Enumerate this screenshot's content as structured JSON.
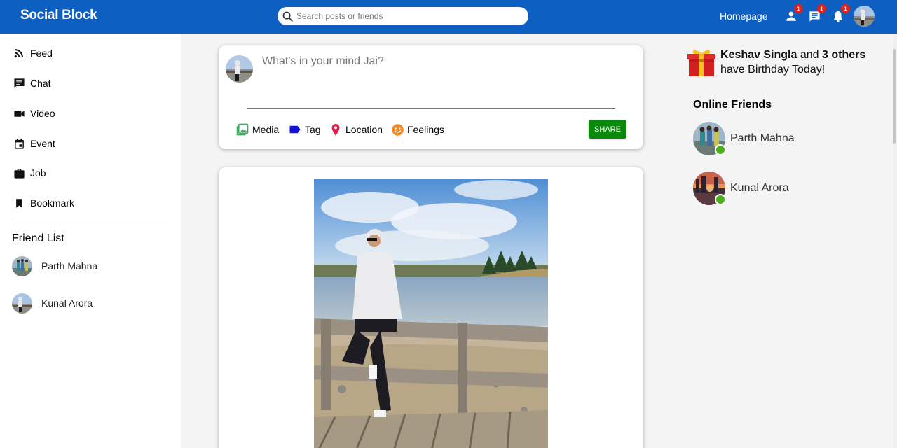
{
  "app": {
    "name": "Social Block"
  },
  "header": {
    "search_placeholder": "Search posts or friends",
    "homepage_label": "Homepage",
    "notifications": [
      {
        "icon": "person-icon",
        "count": "1"
      },
      {
        "icon": "chat-icon",
        "count": "1"
      },
      {
        "icon": "bell-icon",
        "count": "1"
      }
    ]
  },
  "sidebar": {
    "items": [
      {
        "label": "Feed",
        "icon": "rss-feed-icon"
      },
      {
        "label": "Chat",
        "icon": "chat-icon"
      },
      {
        "label": "Video",
        "icon": "video-camera-icon"
      },
      {
        "label": "Event",
        "icon": "calendar-icon"
      },
      {
        "label": "Job",
        "icon": "briefcase-icon"
      },
      {
        "label": "Bookmark",
        "icon": "bookmark-icon"
      }
    ],
    "friend_list_title": "Friend List",
    "friends": [
      {
        "name": "Parth Mahna"
      },
      {
        "name": "Kunal Arora"
      }
    ]
  },
  "share": {
    "placeholder": "What's in your mind Jai?",
    "options": [
      {
        "label": "Media",
        "icon": "image-icon",
        "color": "#3fae61"
      },
      {
        "label": "Tag",
        "icon": "label-icon",
        "color": "#1212d6"
      },
      {
        "label": "Location",
        "icon": "location-pin-icon",
        "color": "#e01e4a"
      },
      {
        "label": "Feelings",
        "icon": "smiley-icon",
        "color": "#f08a24"
      }
    ],
    "button_label": "SHARE"
  },
  "rightbar": {
    "birthday": {
      "name": "Keshav Singla",
      "joiner": "and",
      "others": "3 others",
      "suffix": "have Birthday Today!"
    },
    "online_title": "Online Friends",
    "online_friends": [
      {
        "name": "Parth Mahna"
      },
      {
        "name": "Kunal Arora"
      }
    ]
  },
  "colors": {
    "topbar": "#0e5fc2",
    "share_button": "#0a8a0a",
    "online": "#4caf1f",
    "badge": "#e2231a"
  }
}
